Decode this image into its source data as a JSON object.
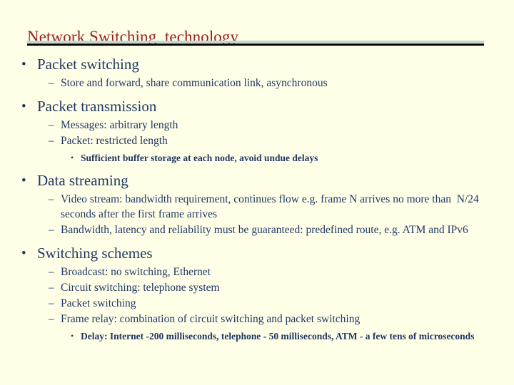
{
  "slide": {
    "title": "Network Switching  technology",
    "title_color": "#98211E",
    "body_color": "#1F3864",
    "background_color": "#FFFFE8",
    "rule_top_color": "#BFD6CB",
    "rule_bottom_color": "#000000",
    "bullets": {
      "level1_glyph": "•",
      "level2_glyph": "–",
      "level3_glyph": "•"
    },
    "content": [
      {
        "level": 1,
        "text": "Packet switching"
      },
      {
        "level": 2,
        "text": "Store and forward, share communication link, asynchronous"
      },
      {
        "level": 1,
        "text": "Packet transmission"
      },
      {
        "level": 2,
        "text": "Messages: arbitrary length"
      },
      {
        "level": 2,
        "text": "Packet: restricted length"
      },
      {
        "level": 3,
        "text": "Sufficient buffer storage at each node, avoid undue delays"
      },
      {
        "level": 1,
        "text": "Data streaming"
      },
      {
        "level": 2,
        "text": "Video stream: bandwidth requirement, continues flow e.g. frame N arrives no more than  N/24 seconds after the first frame arrives"
      },
      {
        "level": 2,
        "text": "Bandwidth, latency and reliability must be guaranteed: predefined route, e.g. ATM and IPv6"
      },
      {
        "level": 1,
        "text": "Switching schemes"
      },
      {
        "level": 2,
        "text": "Broadcast: no switching, Ethernet"
      },
      {
        "level": 2,
        "text": "Circuit switching: telephone system"
      },
      {
        "level": 2,
        "text": "Packet switching"
      },
      {
        "level": 2,
        "text": "Frame relay: combination of circuit switching and packet switching"
      },
      {
        "level": 3,
        "text": "Delay: Internet -200 milliseconds, telephone - 50 milliseconds, ATM - a few tens of microseconds"
      }
    ]
  }
}
